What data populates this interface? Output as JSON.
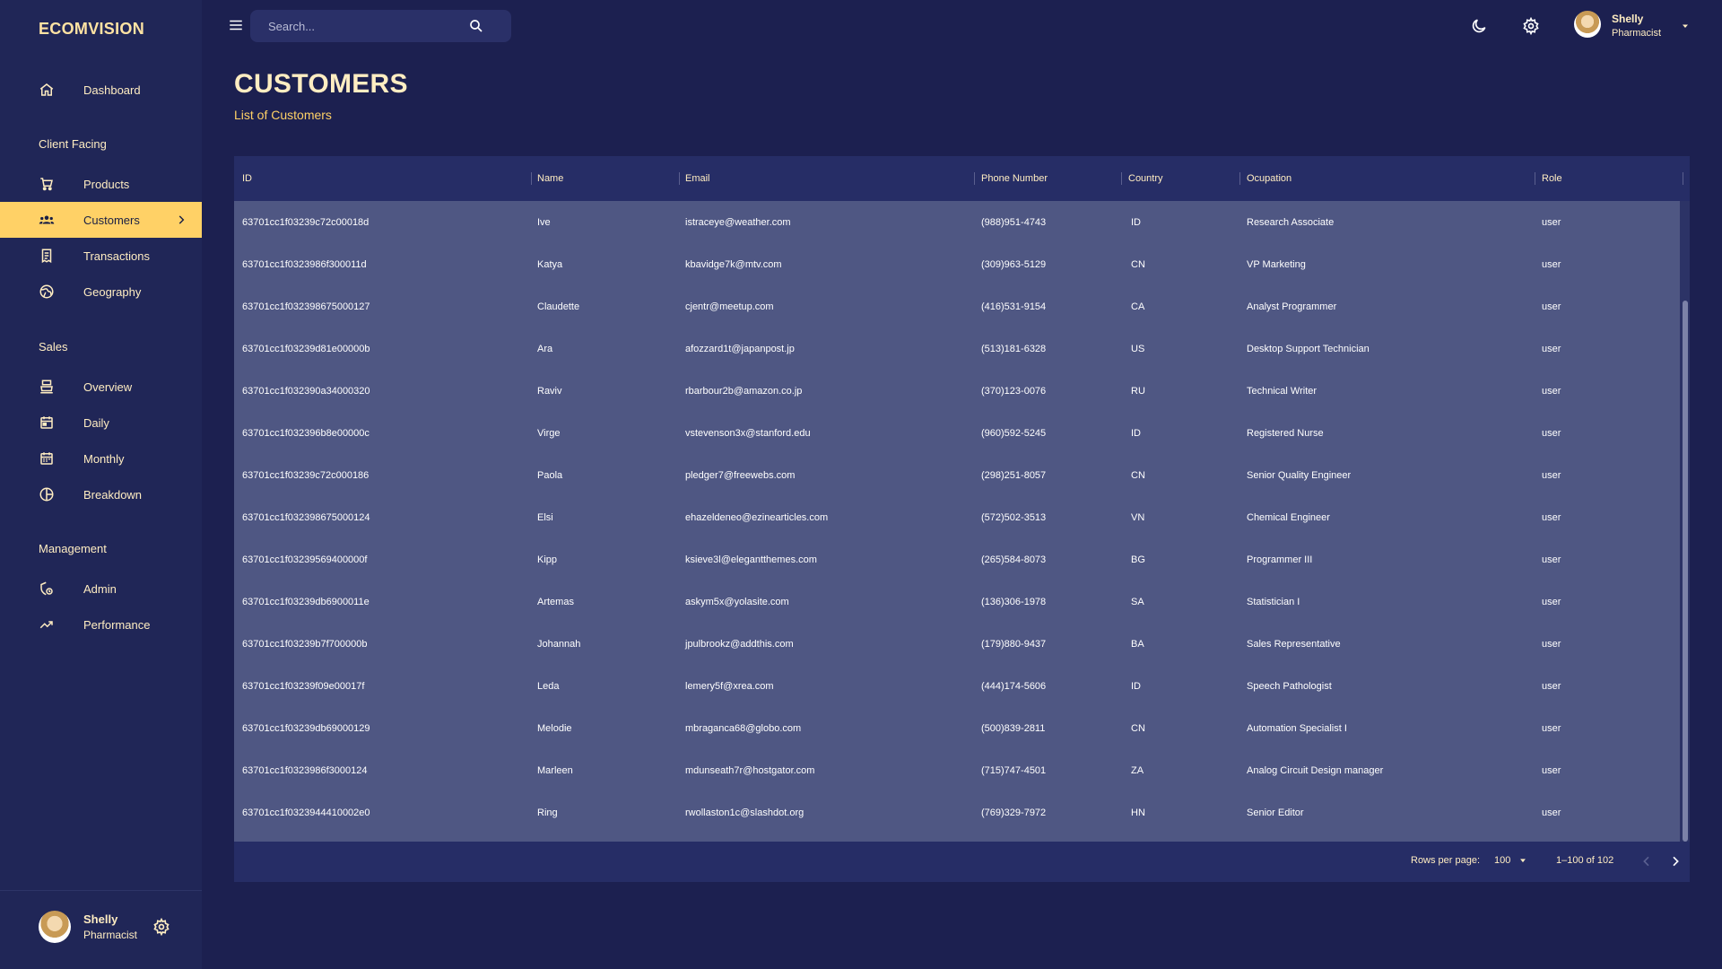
{
  "app": {
    "brand": "ECOMVISION"
  },
  "sidebar": {
    "dashboard": {
      "label": "Dashboard",
      "icon": "home-icon"
    },
    "sections": {
      "client_facing": "Client Facing",
      "sales": "Sales",
      "management": "Management"
    },
    "items": {
      "products": {
        "label": "Products",
        "icon": "shopping-cart-icon"
      },
      "customers": {
        "label": "Customers",
        "icon": "groups-icon",
        "active": true
      },
      "transactions": {
        "label": "Transactions",
        "icon": "receipt-icon"
      },
      "geography": {
        "label": "Geography",
        "icon": "globe-icon"
      },
      "overview": {
        "label": "Overview",
        "icon": "point-of-sale-icon"
      },
      "daily": {
        "label": "Daily",
        "icon": "calendar-today-icon"
      },
      "monthly": {
        "label": "Monthly",
        "icon": "calendar-month-icon"
      },
      "breakdown": {
        "label": "Breakdown",
        "icon": "pie-chart-icon"
      },
      "admin": {
        "label": "Admin",
        "icon": "admin-panel-icon"
      },
      "performance": {
        "label": "Performance",
        "icon": "trending-up-icon"
      }
    },
    "user": {
      "name": "Shelly",
      "role": "Pharmacist"
    }
  },
  "topbar": {
    "search_placeholder": "Search...",
    "user": {
      "name": "Shelly",
      "role": "Pharmacist"
    }
  },
  "header": {
    "title": "CUSTOMERS",
    "subtitle": "List of Customers"
  },
  "table": {
    "columns": [
      "ID",
      "Name",
      "Email",
      "Phone Number",
      "Country",
      "Ocupation",
      "Role"
    ],
    "rows": [
      [
        "63701cc1f03239c72c00018d",
        "Ive",
        "istraceye@weather.com",
        "(988)951-4743",
        "ID",
        "Research Associate",
        "user"
      ],
      [
        "63701cc1f0323986f300011d",
        "Katya",
        "kbavidge7k@mtv.com",
        "(309)963-5129",
        "CN",
        "VP Marketing",
        "user"
      ],
      [
        "63701cc1f032398675000127",
        "Claudette",
        "cjentr@meetup.com",
        "(416)531-9154",
        "CA",
        "Analyst Programmer",
        "user"
      ],
      [
        "63701cc1f03239d81e00000b",
        "Ara",
        "afozzard1t@japanpost.jp",
        "(513)181-6328",
        "US",
        "Desktop Support Technician",
        "user"
      ],
      [
        "63701cc1f032390a34000320",
        "Raviv",
        "rbarbour2b@amazon.co.jp",
        "(370)123-0076",
        "RU",
        "Technical Writer",
        "user"
      ],
      [
        "63701cc1f032396b8e00000c",
        "Virge",
        "vstevenson3x@stanford.edu",
        "(960)592-5245",
        "ID",
        "Registered Nurse",
        "user"
      ],
      [
        "63701cc1f03239c72c000186",
        "Paola",
        "pledger7@freewebs.com",
        "(298)251-8057",
        "CN",
        "Senior Quality Engineer",
        "user"
      ],
      [
        "63701cc1f032398675000124",
        "Elsi",
        "ehazeldeneo@ezinearticles.com",
        "(572)502-3513",
        "VN",
        "Chemical Engineer",
        "user"
      ],
      [
        "63701cc1f03239569400000f",
        "Kipp",
        "ksieve3l@elegantthemes.com",
        "(265)584-8073",
        "BG",
        "Programmer III",
        "user"
      ],
      [
        "63701cc1f03239db6900011e",
        "Artemas",
        "askym5x@yolasite.com",
        "(136)306-1978",
        "SA",
        "Statistician I",
        "user"
      ],
      [
        "63701cc1f03239b7f700000b",
        "Johannah",
        "jpulbrookz@addthis.com",
        "(179)880-9437",
        "BA",
        "Sales Representative",
        "user"
      ],
      [
        "63701cc1f03239f09e00017f",
        "Leda",
        "lemery5f@xrea.com",
        "(444)174-5606",
        "ID",
        "Speech Pathologist",
        "user"
      ],
      [
        "63701cc1f03239db69000129",
        "Melodie",
        "mbraganca68@globo.com",
        "(500)839-2811",
        "CN",
        "Automation Specialist I",
        "user"
      ],
      [
        "63701cc1f0323986f3000124",
        "Marleen",
        "mdunseath7r@hostgator.com",
        "(715)747-4501",
        "ZA",
        "Analog Circuit Design manager",
        "user"
      ],
      [
        "63701cc1f0323944410002e0",
        "Ring",
        "rwollaston1c@slashdot.org",
        "(769)329-7972",
        "HN",
        "Senior Editor",
        "user"
      ]
    ]
  },
  "pagination": {
    "rows_per_page_label": "Rows per page:",
    "rows_per_page": "100",
    "range": "1–100 of 102"
  },
  "colors": {
    "background": "#1c2050",
    "sidebar": "#202657",
    "accent": "#ffd166",
    "text_light": "#ffedc2",
    "table_body": "#4f5783"
  }
}
